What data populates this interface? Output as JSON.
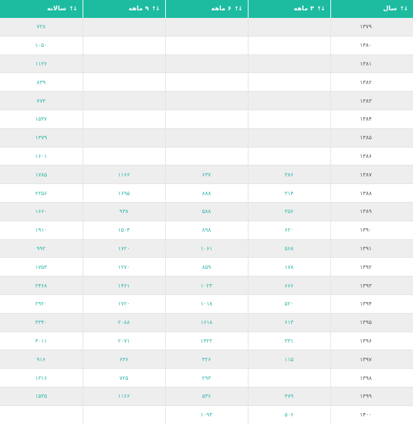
{
  "headers": [
    {
      "label": "سال"
    },
    {
      "label": "۳ ماهه"
    },
    {
      "label": "۶ ماهه"
    },
    {
      "label": "۹ ماهه"
    },
    {
      "label": "سالانه"
    }
  ],
  "rows": [
    {
      "year": "۱۳۷۹",
      "q3": "",
      "q6": "",
      "q9": "",
      "annual": "۷۲۸"
    },
    {
      "year": "۱۳۸۰",
      "q3": "",
      "q6": "",
      "q9": "",
      "annual": "۱۰۵۰"
    },
    {
      "year": "۱۳۸۱",
      "q3": "",
      "q6": "",
      "q9": "",
      "annual": "۱۱۳۶"
    },
    {
      "year": "۱۳۸۲",
      "q3": "",
      "q6": "",
      "q9": "",
      "annual": "۸۳۹"
    },
    {
      "year": "۱۳۸۳",
      "q3": "",
      "q6": "",
      "q9": "",
      "annual": "۷۷۳"
    },
    {
      "year": "۱۳۸۴",
      "q3": "",
      "q6": "",
      "q9": "",
      "annual": "۱۵۳۷"
    },
    {
      "year": "۱۳۸۵",
      "q3": "",
      "q6": "",
      "q9": "",
      "annual": "۱۳۷۹"
    },
    {
      "year": "۱۳۸۶",
      "q3": "",
      "q6": "",
      "q9": "",
      "annual": "۱۶۰۱"
    },
    {
      "year": "۱۳۸۷",
      "q3": "۳۸۶",
      "q6": "۶۳۷",
      "q9": "۱۱۶۶",
      "annual": "۱۷۸۵"
    },
    {
      "year": "۱۳۸۸",
      "q3": "۳۱۴",
      "q6": "۸۸۸",
      "q9": "۱۶۹۵",
      "annual": "۲۲۵۶"
    },
    {
      "year": "۱۳۸۹",
      "q3": "۳۵۶",
      "q6": "۵۸۸",
      "q9": "۹۳۸",
      "annual": "۱۶۶۰"
    },
    {
      "year": "۱۳۹۰",
      "q3": "۶۲۰",
      "q6": "۸۹۸",
      "q9": "۱۵۰۴",
      "annual": "۱۹۱۰"
    },
    {
      "year": "۱۳۹۱",
      "q3": "۵۶۸",
      "q6": "۱۰۶۱",
      "q9": "۱۷۲۰",
      "annual": "۹۹۲"
    },
    {
      "year": "۱۳۹۲",
      "q3": "۱۷۸",
      "q6": "۸۵۹",
      "q9": "۱۲۷۰",
      "annual": "۱۷۵۳"
    },
    {
      "year": "۱۳۹۳",
      "q3": "۶۶۶",
      "q6": "۱۰۲۳",
      "q9": "۱۴۶۱",
      "annual": "۲۴۶۸"
    },
    {
      "year": "۱۳۹۴",
      "q3": "۵۲۰",
      "q6": "۱۰۱۸",
      "q9": "۱۷۲۰",
      "annual": "۲۹۲۰"
    },
    {
      "year": "۱۳۹۵",
      "q3": "۶۱۳",
      "q6": "۱۶۱۸",
      "q9": "۲۰۸۸",
      "annual": "۳۳۴۰"
    },
    {
      "year": "۱۳۹۶",
      "q3": "۳۳۱",
      "q6": "۱۴۲۲",
      "q9": "۲۰۷۱",
      "annual": "۳۰۱۱"
    },
    {
      "year": "۱۳۹۷",
      "q3": "۱۱۵",
      "q6": "۳۲۶",
      "q9": "۶۳۶",
      "annual": "۹۱۶"
    },
    {
      "year": "۱۳۹۸",
      "q3": "",
      "q6": "۲۹۳",
      "q9": "۷۲۵",
      "annual": "۱۳۱۶"
    },
    {
      "year": "۱۳۹۹",
      "q3": "۴۷۹",
      "q6": "۵۳۶",
      "q9": "۱۱۶۶",
      "annual": "۱۵۳۵"
    },
    {
      "year": "۱۴۰۰",
      "q3": "۵۰۶",
      "q6": "۱۰۹۳",
      "q9": "",
      "annual": ""
    }
  ]
}
